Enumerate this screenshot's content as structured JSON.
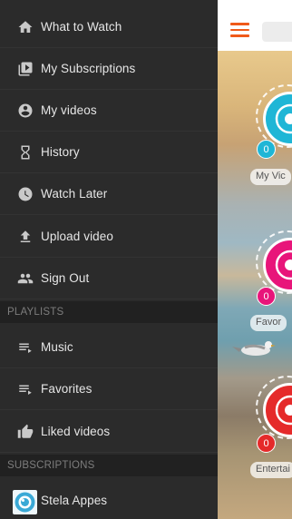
{
  "sidebar": {
    "items": [
      {
        "label": "What to Watch",
        "icon": "home-icon"
      },
      {
        "label": "My Subscriptions",
        "icon": "subscriptions-icon"
      },
      {
        "label": "My videos",
        "icon": "account-circle-icon"
      },
      {
        "label": "History",
        "icon": "hourglass-icon"
      },
      {
        "label": "Watch Later",
        "icon": "clock-icon"
      },
      {
        "label": "Upload video",
        "icon": "upload-icon"
      },
      {
        "label": "Sign Out",
        "icon": "people-icon"
      }
    ],
    "playlists_header": "PLAYLISTS",
    "playlists": [
      {
        "label": "Music",
        "icon": "playlist-icon"
      },
      {
        "label": "Favorites",
        "icon": "playlist-icon"
      },
      {
        "label": "Liked videos",
        "icon": "thumbs-up-icon"
      }
    ],
    "subscriptions_header": "SUBSCRIPTIONS",
    "subscriptions": [
      {
        "label": "Stela Appes",
        "icon": "channel-avatar"
      }
    ]
  },
  "main": {
    "tiles": [
      {
        "label": "My Vic",
        "count": "0",
        "color": "#1fb6d6"
      },
      {
        "label": "Favor",
        "count": "0",
        "color": "#e8157a"
      },
      {
        "label": "Entertai",
        "count": "0",
        "color": "#e52a2a"
      }
    ]
  },
  "colors": {
    "accent": "#f05a1a",
    "sidebar": "#2b2b2b"
  }
}
